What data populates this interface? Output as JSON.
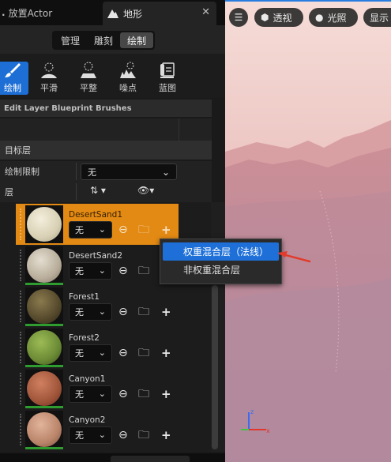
{
  "tabs": {
    "place_actors": "放置Actor",
    "landscape": "地形",
    "landscape_close": "✕"
  },
  "modes": [
    "管理",
    "雕刻",
    "绘制"
  ],
  "active_mode": "绘制",
  "tools": [
    {
      "label": "绘制",
      "icon": "brush-icon",
      "active": true
    },
    {
      "label": "平滑",
      "icon": "smooth-icon",
      "active": false
    },
    {
      "label": "平整",
      "icon": "flatten-icon",
      "active": false
    },
    {
      "label": "噪点",
      "icon": "noise-icon",
      "active": false
    },
    {
      "label": "蓝图",
      "icon": "blueprint-icon",
      "active": false
    }
  ],
  "section_title": "Edit Layer Blueprint Brushes",
  "target_layers": {
    "heading": "目标层",
    "paint_restriction_label": "绘制限制",
    "paint_restriction_value": "无",
    "layers_label": "层",
    "sort_icon": "sort-icon",
    "visibility_icon": "eye-icon"
  },
  "layers": [
    {
      "name": "DesertSand1",
      "value": "无",
      "selected": true
    },
    {
      "name": "DesertSand2",
      "value": "无",
      "selected": false
    },
    {
      "name": "Forest1",
      "value": "无",
      "selected": false
    },
    {
      "name": "Forest2",
      "value": "无",
      "selected": false
    },
    {
      "name": "Canyon1",
      "value": "无",
      "selected": false
    },
    {
      "name": "Canyon2",
      "value": "无",
      "selected": false
    }
  ],
  "context_menu": {
    "items": [
      "权重混合层（法线）",
      "非权重混合层"
    ],
    "highlighted_index": 0
  },
  "viewport": {
    "menu_icon": "hamburger-icon",
    "perspective_label": "透视",
    "lit_label": "光照",
    "show_label": "显示"
  },
  "colors": {
    "accent_blue": "#1d6fd6",
    "selected_layer_orange": "#e28a13",
    "layer_bar_green": "#2e9c2e"
  }
}
